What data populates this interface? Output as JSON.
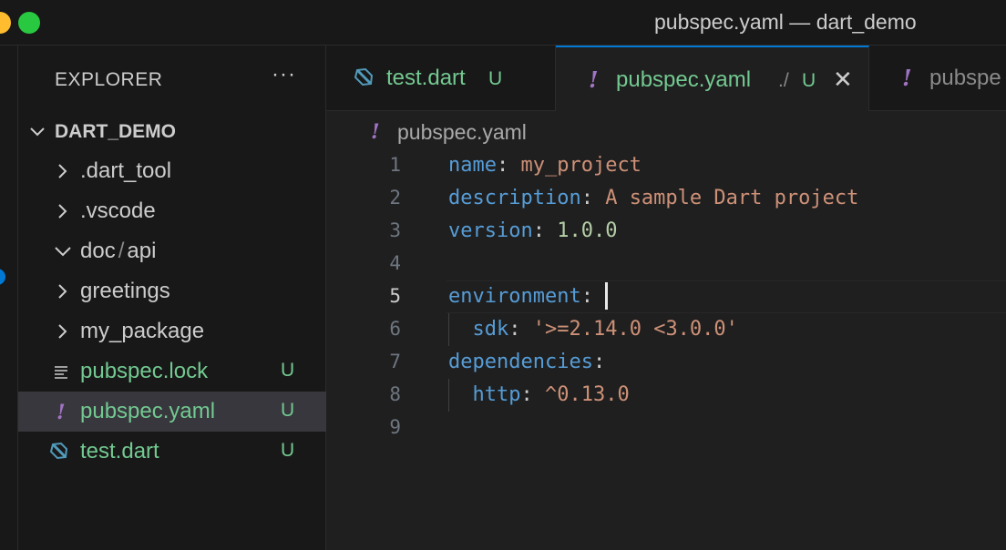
{
  "window": {
    "title": "pubspec.yaml — dart_demo"
  },
  "colors": {
    "accent": "#0078d4",
    "untracked": "#73c991",
    "yaml_icon": "#a074c4",
    "dart_icon": "#519aba"
  },
  "explorer": {
    "header": "EXPLORER",
    "more_label": "···",
    "section": "DART_DEMO",
    "items": [
      {
        "name": ".dart_tool",
        "type": "folder",
        "expanded": false,
        "badge": "",
        "icon": "chevron-right-icon"
      },
      {
        "name": ".vscode",
        "type": "folder",
        "expanded": false,
        "badge": "",
        "icon": "chevron-right-icon"
      },
      {
        "name_part1": "doc",
        "name_sep": "/",
        "name_part2": "api",
        "type": "folder",
        "expanded": true,
        "badge": "",
        "icon": "chevron-down-icon"
      },
      {
        "name": "greetings",
        "type": "folder",
        "expanded": false,
        "badge": "",
        "icon": "chevron-right-icon"
      },
      {
        "name": "my_package",
        "type": "folder",
        "expanded": false,
        "badge": "",
        "icon": "chevron-right-icon"
      },
      {
        "name": "pubspec.lock",
        "type": "file",
        "badge": "U",
        "icon": "lines-file-icon"
      },
      {
        "name": "pubspec.yaml",
        "type": "file",
        "badge": "U",
        "icon": "yaml-file-icon",
        "selected": true
      },
      {
        "name": "test.dart",
        "type": "file",
        "badge": "U",
        "icon": "dart-file-icon"
      }
    ]
  },
  "tabs": [
    {
      "label": "test.dart",
      "badge": "U",
      "icon": "dart-file-icon"
    },
    {
      "label": "pubspec.yaml",
      "description": "./",
      "badge": "U",
      "icon": "yaml-file-icon",
      "active": true,
      "close": "✕"
    },
    {
      "label": "pubspe",
      "icon": "yaml-file-icon"
    }
  ],
  "breadcrumb": {
    "file": "pubspec.yaml",
    "icon_glyph": "!"
  },
  "editor": {
    "current_line": 5,
    "lines": [
      {
        "num": "1",
        "key": "name",
        "colon": ":",
        "value": " my_project",
        "value_type": "str"
      },
      {
        "num": "2",
        "key": "description",
        "colon": ":",
        "value": " A sample Dart project",
        "value_type": "str"
      },
      {
        "num": "3",
        "key": "version",
        "colon": ":",
        "value": " 1.0.0",
        "value_type": "num"
      },
      {
        "num": "4",
        "key": "",
        "colon": "",
        "value": "",
        "value_type": ""
      },
      {
        "num": "5",
        "key": "environment",
        "colon": ":",
        "value": "",
        "value_type": ""
      },
      {
        "num": "6",
        "indent": "  ",
        "key": "sdk",
        "colon": ":",
        "value": " '>=2.14.0 <3.0.0'",
        "value_type": "str"
      },
      {
        "num": "7",
        "key": "dependencies",
        "colon": ":",
        "value": "",
        "value_type": ""
      },
      {
        "num": "8",
        "indent": "  ",
        "key": "http",
        "colon": ":",
        "value": " ^0.13.0",
        "value_type": "str"
      },
      {
        "num": "9",
        "key": "",
        "colon": "",
        "value": "",
        "value_type": ""
      }
    ]
  }
}
